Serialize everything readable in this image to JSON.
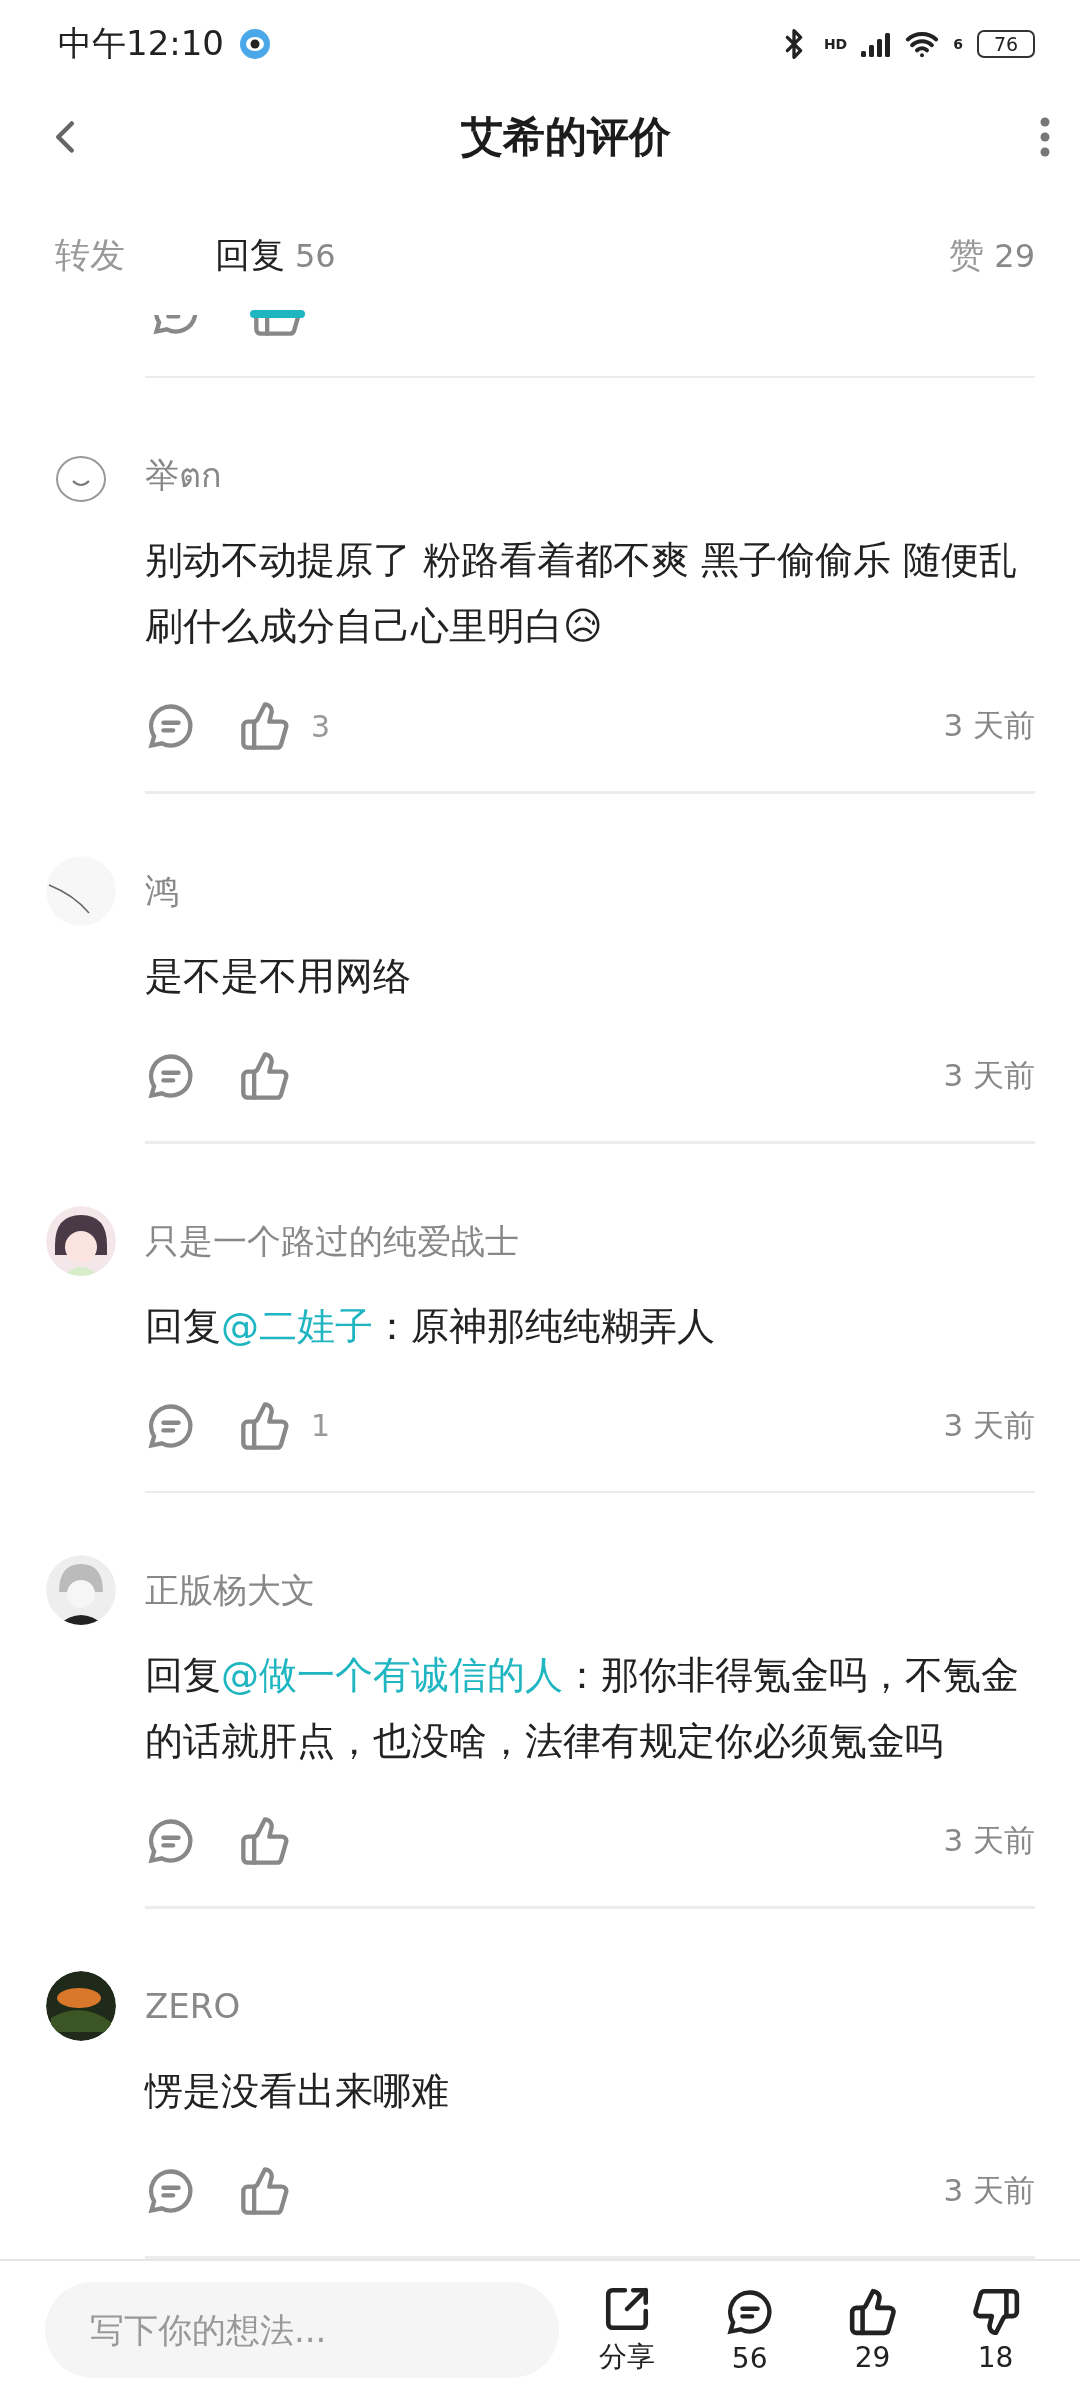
{
  "status_bar": {
    "time": "中午12:10",
    "network_label": "HD",
    "wifi_label": "6",
    "battery": "76"
  },
  "header": {
    "title": "艾希的评价"
  },
  "tabs": [
    {
      "label": "转发",
      "selected": false
    },
    {
      "label": "回复",
      "count": "56",
      "selected": true
    },
    {
      "label": "赞",
      "count": "29",
      "selected": false
    }
  ],
  "comments": [
    {
      "name": "举ตก",
      "text": "别动不动提原了 粉路看着都不爽 黑子偷偷乐 随便乱刷什么成分自己心里明白😥",
      "likes": "3",
      "time": "3 天前"
    },
    {
      "name": "鸿",
      "text": "是不是不用网络",
      "time": "3 天前"
    },
    {
      "name": "只是一个路过的纯爱战士",
      "reply_prefix": "回复",
      "mention": "@二娃子",
      "text": "：原神那纯纯糊弄人",
      "likes": "1",
      "time": "3 天前"
    },
    {
      "name": "正版杨大文",
      "reply_prefix": "回复",
      "mention": "@做一个有诚信的人",
      "text": "：那你非得氪金吗，不氪金的话就肝点，也没啥，法律有规定你必须氪金吗",
      "time": "3 天前"
    },
    {
      "name": "ZERO",
      "text": "愣是没看出来哪难",
      "time": "3 天前"
    }
  ],
  "bottom_bar": {
    "placeholder": "写下你的想法...",
    "share_label": "分享",
    "comments": "56",
    "likes": "29",
    "dislikes": "18"
  }
}
